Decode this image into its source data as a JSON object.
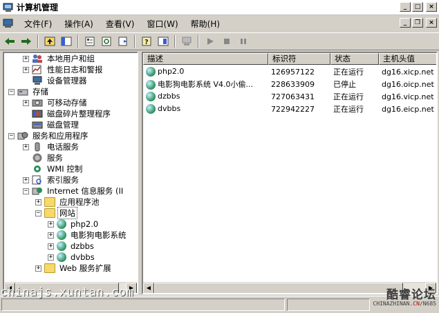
{
  "window": {
    "title": "计算机管理"
  },
  "menu": [
    {
      "label": "文件(F)"
    },
    {
      "label": "操作(A)"
    },
    {
      "label": "查看(V)"
    },
    {
      "label": "窗口(W)"
    },
    {
      "label": "帮助(H)"
    }
  ],
  "tree": [
    {
      "label": "本地用户和组",
      "icon": "users-icon"
    },
    {
      "label": "性能日志和警报",
      "icon": "perf-log-icon"
    },
    {
      "label": "设备管理器",
      "icon": "device-manager-icon"
    },
    {
      "label": "存储",
      "icon": "storage-icon"
    },
    {
      "label": "可移动存储",
      "icon": "removable-storage-icon"
    },
    {
      "label": "磁盘碎片整理程序",
      "icon": "defrag-icon"
    },
    {
      "label": "磁盘管理",
      "icon": "disk-management-icon"
    },
    {
      "label": "服务和应用程序",
      "icon": "services-apps-icon"
    },
    {
      "label": "电话服务",
      "icon": "telephony-icon"
    },
    {
      "label": "服务",
      "icon": "services-icon"
    },
    {
      "label": "WMI 控制",
      "icon": "wmi-icon"
    },
    {
      "label": "索引服务",
      "icon": "indexing-icon"
    },
    {
      "label": "Internet 信息服务 (II",
      "icon": "iis-icon"
    },
    {
      "label": "应用程序池",
      "icon": "folder-icon"
    },
    {
      "label": "网站",
      "icon": "folder-open-icon"
    },
    {
      "label": "php2.0",
      "icon": "globe-icon"
    },
    {
      "label": "电影狗电影系统",
      "icon": "globe-icon"
    },
    {
      "label": "dzbbs",
      "icon": "globe-icon"
    },
    {
      "label": "dvbbs",
      "icon": "globe-icon"
    },
    {
      "label": "Web 服务扩展",
      "icon": "folder-icon"
    }
  ],
  "list": {
    "columns": [
      "描述",
      "标识符",
      "状态",
      "主机头值"
    ],
    "rows": [
      {
        "desc": "php2.0",
        "id": "126957122",
        "status": "正在运行",
        "host": "dg16.xicp.net"
      },
      {
        "desc": "电影狗电影系统 V4.0小偷...",
        "id": "228633909",
        "status": "已停止",
        "host": "dg16.oicp.net"
      },
      {
        "desc": "dzbbs",
        "id": "727063431",
        "status": "正在运行",
        "host": "dg16.vicp.net"
      },
      {
        "desc": "dvbbs",
        "id": "722942227",
        "status": "正在运行",
        "host": "dg16.eicp.net"
      }
    ]
  },
  "watermark": "chinajs.xuntan.com",
  "logo": {
    "big": "酷睿论坛",
    "small_a": "CHINAZHINAN",
    "small_b": "CN",
    "small_c": "N685"
  },
  "colors": {
    "selection_outline": "#404040",
    "face": "#d4d0c8"
  }
}
